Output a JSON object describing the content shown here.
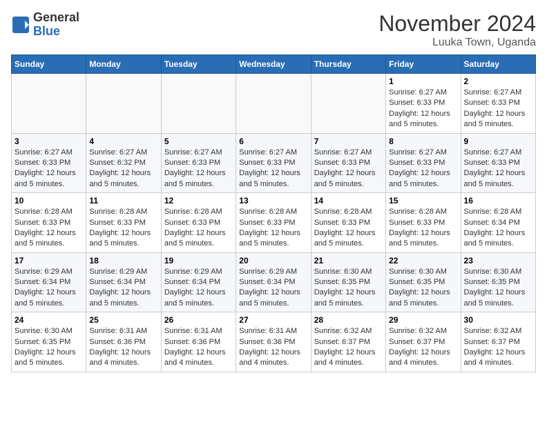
{
  "header": {
    "logo_general": "General",
    "logo_blue": "Blue",
    "month_title": "November 2024",
    "subtitle": "Luuka Town, Uganda"
  },
  "days_of_week": [
    "Sunday",
    "Monday",
    "Tuesday",
    "Wednesday",
    "Thursday",
    "Friday",
    "Saturday"
  ],
  "weeks": [
    [
      {
        "day": "",
        "info": ""
      },
      {
        "day": "",
        "info": ""
      },
      {
        "day": "",
        "info": ""
      },
      {
        "day": "",
        "info": ""
      },
      {
        "day": "",
        "info": ""
      },
      {
        "day": "1",
        "info": "Sunrise: 6:27 AM\nSunset: 6:33 PM\nDaylight: 12 hours and 5 minutes."
      },
      {
        "day": "2",
        "info": "Sunrise: 6:27 AM\nSunset: 6:33 PM\nDaylight: 12 hours and 5 minutes."
      }
    ],
    [
      {
        "day": "3",
        "info": "Sunrise: 6:27 AM\nSunset: 6:33 PM\nDaylight: 12 hours and 5 minutes."
      },
      {
        "day": "4",
        "info": "Sunrise: 6:27 AM\nSunset: 6:32 PM\nDaylight: 12 hours and 5 minutes."
      },
      {
        "day": "5",
        "info": "Sunrise: 6:27 AM\nSunset: 6:33 PM\nDaylight: 12 hours and 5 minutes."
      },
      {
        "day": "6",
        "info": "Sunrise: 6:27 AM\nSunset: 6:33 PM\nDaylight: 12 hours and 5 minutes."
      },
      {
        "day": "7",
        "info": "Sunrise: 6:27 AM\nSunset: 6:33 PM\nDaylight: 12 hours and 5 minutes."
      },
      {
        "day": "8",
        "info": "Sunrise: 6:27 AM\nSunset: 6:33 PM\nDaylight: 12 hours and 5 minutes."
      },
      {
        "day": "9",
        "info": "Sunrise: 6:27 AM\nSunset: 6:33 PM\nDaylight: 12 hours and 5 minutes."
      }
    ],
    [
      {
        "day": "10",
        "info": "Sunrise: 6:28 AM\nSunset: 6:33 PM\nDaylight: 12 hours and 5 minutes."
      },
      {
        "day": "11",
        "info": "Sunrise: 6:28 AM\nSunset: 6:33 PM\nDaylight: 12 hours and 5 minutes."
      },
      {
        "day": "12",
        "info": "Sunrise: 6:28 AM\nSunset: 6:33 PM\nDaylight: 12 hours and 5 minutes."
      },
      {
        "day": "13",
        "info": "Sunrise: 6:28 AM\nSunset: 6:33 PM\nDaylight: 12 hours and 5 minutes."
      },
      {
        "day": "14",
        "info": "Sunrise: 6:28 AM\nSunset: 6:33 PM\nDaylight: 12 hours and 5 minutes."
      },
      {
        "day": "15",
        "info": "Sunrise: 6:28 AM\nSunset: 6:33 PM\nDaylight: 12 hours and 5 minutes."
      },
      {
        "day": "16",
        "info": "Sunrise: 6:28 AM\nSunset: 6:34 PM\nDaylight: 12 hours and 5 minutes."
      }
    ],
    [
      {
        "day": "17",
        "info": "Sunrise: 6:29 AM\nSunset: 6:34 PM\nDaylight: 12 hours and 5 minutes."
      },
      {
        "day": "18",
        "info": "Sunrise: 6:29 AM\nSunset: 6:34 PM\nDaylight: 12 hours and 5 minutes."
      },
      {
        "day": "19",
        "info": "Sunrise: 6:29 AM\nSunset: 6:34 PM\nDaylight: 12 hours and 5 minutes."
      },
      {
        "day": "20",
        "info": "Sunrise: 6:29 AM\nSunset: 6:34 PM\nDaylight: 12 hours and 5 minutes."
      },
      {
        "day": "21",
        "info": "Sunrise: 6:30 AM\nSunset: 6:35 PM\nDaylight: 12 hours and 5 minutes."
      },
      {
        "day": "22",
        "info": "Sunrise: 6:30 AM\nSunset: 6:35 PM\nDaylight: 12 hours and 5 minutes."
      },
      {
        "day": "23",
        "info": "Sunrise: 6:30 AM\nSunset: 6:35 PM\nDaylight: 12 hours and 5 minutes."
      }
    ],
    [
      {
        "day": "24",
        "info": "Sunrise: 6:30 AM\nSunset: 6:35 PM\nDaylight: 12 hours and 5 minutes."
      },
      {
        "day": "25",
        "info": "Sunrise: 6:31 AM\nSunset: 6:36 PM\nDaylight: 12 hours and 4 minutes."
      },
      {
        "day": "26",
        "info": "Sunrise: 6:31 AM\nSunset: 6:36 PM\nDaylight: 12 hours and 4 minutes."
      },
      {
        "day": "27",
        "info": "Sunrise: 6:31 AM\nSunset: 6:36 PM\nDaylight: 12 hours and 4 minutes."
      },
      {
        "day": "28",
        "info": "Sunrise: 6:32 AM\nSunset: 6:37 PM\nDaylight: 12 hours and 4 minutes."
      },
      {
        "day": "29",
        "info": "Sunrise: 6:32 AM\nSunset: 6:37 PM\nDaylight: 12 hours and 4 minutes."
      },
      {
        "day": "30",
        "info": "Sunrise: 6:32 AM\nSunset: 6:37 PM\nDaylight: 12 hours and 4 minutes."
      }
    ]
  ]
}
